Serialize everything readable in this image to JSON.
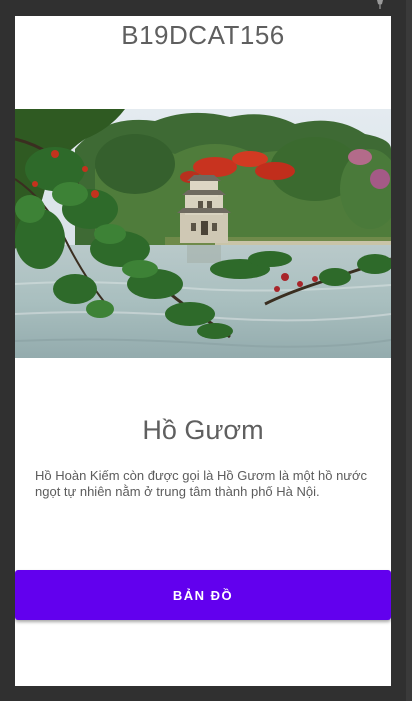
{
  "header": {
    "app_id": "B19DCAT156"
  },
  "hero": {
    "image_subject": "hoan-kiem-lake-turtle-tower-photo"
  },
  "place": {
    "title": "Hồ Gươm",
    "description": "Hồ Hoàn Kiếm còn được gọi là Hồ Gươm là một hồ nước ngọt tự nhiên nằm ở trung tâm thành phố Hà Nội."
  },
  "actions": {
    "map_button_label": "BẢN ĐỒ"
  },
  "colors": {
    "accent": "#6200ee",
    "background": "#303030",
    "screen": "#ffffff",
    "text": "#5f5f5f"
  }
}
